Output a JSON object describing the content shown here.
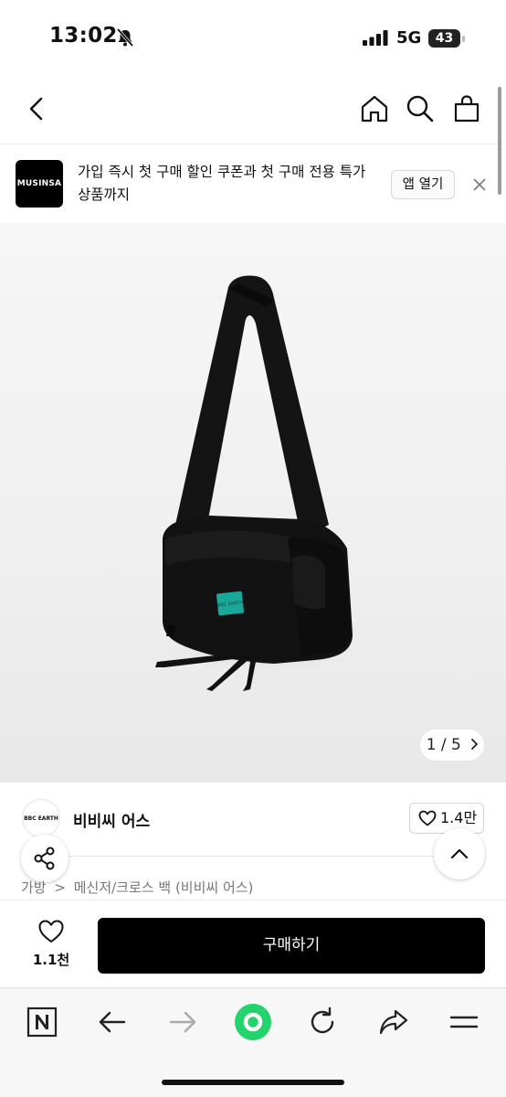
{
  "status_bar": {
    "time": "13:02",
    "network": "5G",
    "battery": "43"
  },
  "icons": {
    "back": "chevron-left-icon",
    "home": "home-icon",
    "search": "search-icon",
    "cart": "shopping-bag-icon",
    "close": "close-icon",
    "share": "share-icon",
    "up": "chevron-up-icon",
    "heart": "heart-icon",
    "browser": [
      "naver-n-icon",
      "arrow-left-icon",
      "arrow-right-icon",
      "green-dot-icon",
      "refresh-icon",
      "share-arrow-icon",
      "menu-icon"
    ]
  },
  "banner": {
    "logo": "MUSINSA",
    "text": "가입 즉시 첫 구매 할인 쿠폰과 첫 구매 전용 특가 상품까지",
    "open_app": "앱 열기"
  },
  "product": {
    "image_pager": "1 / 5",
    "tag_text": "BBC EARTH",
    "brand_logo": "BBC EARTH",
    "brand_name": "비비씨 어스",
    "likes": "1.4만",
    "breadcrumb": {
      "category": "가방",
      "separator": ">",
      "subcategory": "메신저/크로스 백 (비비씨 어스)"
    }
  },
  "buy_bar": {
    "wish_count": "1.1천",
    "buy_label": "구매하기"
  },
  "colors": {
    "accent": "#000000",
    "browser_green": "#22d46b",
    "bag_tag": "#1aa89a"
  }
}
